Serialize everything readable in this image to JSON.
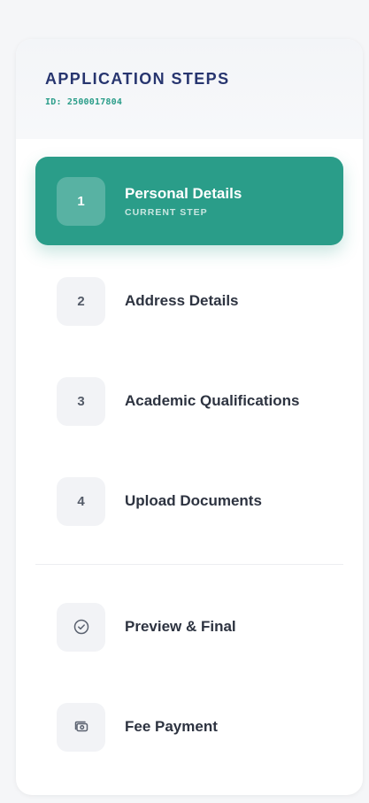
{
  "header": {
    "title": "APPLICATION STEPS",
    "id_text": "ID: 2500017804"
  },
  "steps": [
    {
      "number": "1",
      "label": "Personal Details",
      "sublabel": "CURRENT STEP",
      "active": true
    },
    {
      "number": "2",
      "label": "Address Details",
      "active": false
    },
    {
      "number": "3",
      "label": "Academic Qualifications",
      "active": false
    },
    {
      "number": "4",
      "label": "Upload Documents",
      "active": false
    }
  ],
  "extra_steps": [
    {
      "label": "Preview & Final",
      "icon": "check-circle-icon"
    },
    {
      "label": "Fee Payment",
      "icon": "payment-icon"
    }
  ],
  "colors": {
    "accent": "#2a9d89",
    "title": "#27356f",
    "text": "#2d3340"
  }
}
